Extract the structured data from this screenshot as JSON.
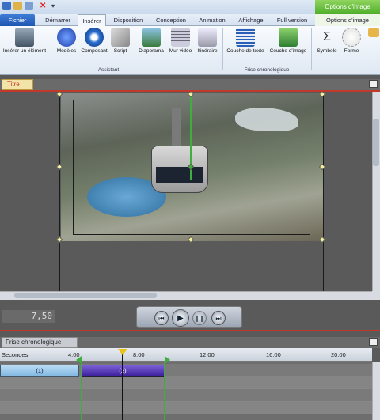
{
  "quick_access": {
    "icons": [
      "save-icon",
      "open-icon",
      "undo-icon",
      "delete-icon",
      "dropdown-icon"
    ]
  },
  "context_group": "Options d'image",
  "tabs": [
    {
      "label": "Fichier"
    },
    {
      "label": "Démarrer"
    },
    {
      "label": "Insérer"
    },
    {
      "label": "Disposition"
    },
    {
      "label": "Conception"
    },
    {
      "label": "Animation"
    },
    {
      "label": "Affichage"
    },
    {
      "label": "Full version"
    },
    {
      "label": "Options d'image"
    }
  ],
  "ribbon": {
    "buttons": [
      {
        "label": "Insérer un élément",
        "icon": "insert-element-icon"
      },
      {
        "label": "Modèles",
        "icon": "star-icon"
      },
      {
        "label": "Composant",
        "icon": "component-icon"
      },
      {
        "label": "Script",
        "icon": "script-icon"
      },
      {
        "label": "Diaporama",
        "icon": "slideshow-icon"
      },
      {
        "label": "Mur vidéo",
        "icon": "video-wall-icon"
      },
      {
        "label": "Itinéraire",
        "icon": "plane-icon"
      },
      {
        "label": "Couche de texte",
        "icon": "text-layer-icon"
      },
      {
        "label": "Couche d'image",
        "icon": "image-layer-icon"
      },
      {
        "label": "Symbole",
        "icon": "sigma-icon"
      },
      {
        "label": "Forme",
        "icon": "shape-icon"
      }
    ],
    "groups": [
      "Assistant",
      "Frise chronologique"
    ]
  },
  "stage": {
    "tab_label": "Titre"
  },
  "player": {
    "time": "7,50",
    "controls": [
      "skip-back-icon",
      "play-icon",
      "pause-icon",
      "skip-forward-icon"
    ]
  },
  "timeline": {
    "tab_label": "Frise chronologique",
    "ruler_label": "Secondes",
    "ticks": [
      "4:00",
      "8:00",
      "12:00",
      "16:00",
      "20:00"
    ],
    "clips": [
      {
        "label": "(1)"
      },
      {
        "label": "(2)"
      }
    ]
  }
}
